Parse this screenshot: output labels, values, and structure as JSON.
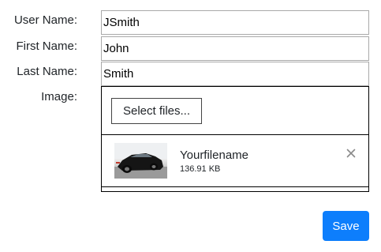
{
  "form": {
    "username_label": "User Name:",
    "username_value": "JSmith",
    "firstname_label": "First Name:",
    "firstname_value": "John",
    "lastname_label": "Last Name:",
    "lastname_value": "Smith",
    "image_label": "Image:"
  },
  "upload": {
    "select_label": "Select files...",
    "file": {
      "name": "Yourfilename",
      "size": "136.91 KB",
      "thumbnail": "car-photo",
      "remove_icon": "close-icon"
    }
  },
  "actions": {
    "save_label": "Save"
  },
  "colors": {
    "primary": "#0d7efc",
    "field_border": "#a9a9a9",
    "remove_icon": "#8a8a8a"
  }
}
